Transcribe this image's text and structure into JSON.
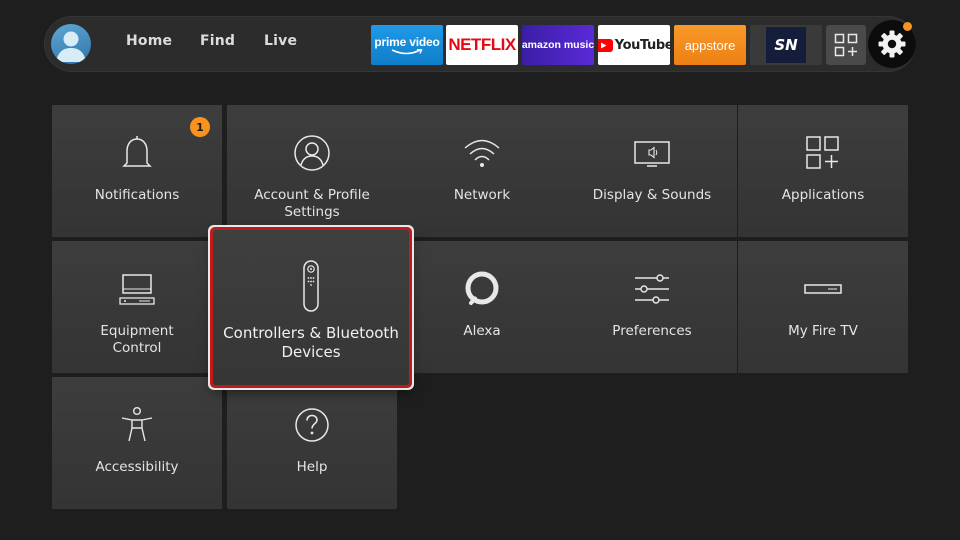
{
  "topbar": {
    "nav": [
      "Home",
      "Find",
      "Live"
    ],
    "apps": [
      {
        "name": "prime video",
        "icon": "prime-video-logo"
      },
      {
        "name": "NETFLIX",
        "icon": "netflix-logo"
      },
      {
        "name": "amazon music",
        "icon": "amazon-music-logo"
      },
      {
        "name": "YouTube",
        "icon": "youtube-logo"
      },
      {
        "name": "appstore",
        "icon": "appstore-logo"
      },
      {
        "name": "SN",
        "icon": "sportsnet-logo"
      }
    ],
    "colors": {
      "accent_orange": "#f7931e",
      "focus_red": "#c11a1a"
    }
  },
  "settings": {
    "tiles": [
      {
        "label": "Notifications",
        "icon": "bell-icon",
        "badge": "1"
      },
      {
        "label": "Account & Profile\nSettings",
        "icon": "profile-icon"
      },
      {
        "label": "Network",
        "icon": "wifi-icon"
      },
      {
        "label": "Display & Sounds",
        "icon": "display-icon"
      },
      {
        "label": "Applications",
        "icon": "apps-icon"
      },
      {
        "label": "Equipment\nControl",
        "icon": "equipment-icon"
      },
      {
        "label": "Controllers & Bluetooth\nDevices",
        "icon": "remote-icon",
        "focused": true
      },
      {
        "label": "Alexa",
        "icon": "alexa-icon"
      },
      {
        "label": "Preferences",
        "icon": "sliders-icon"
      },
      {
        "label": "My Fire TV",
        "icon": "firetv-icon"
      },
      {
        "label": "Accessibility",
        "icon": "accessibility-icon"
      },
      {
        "label": "Help",
        "icon": "help-icon"
      }
    ]
  }
}
